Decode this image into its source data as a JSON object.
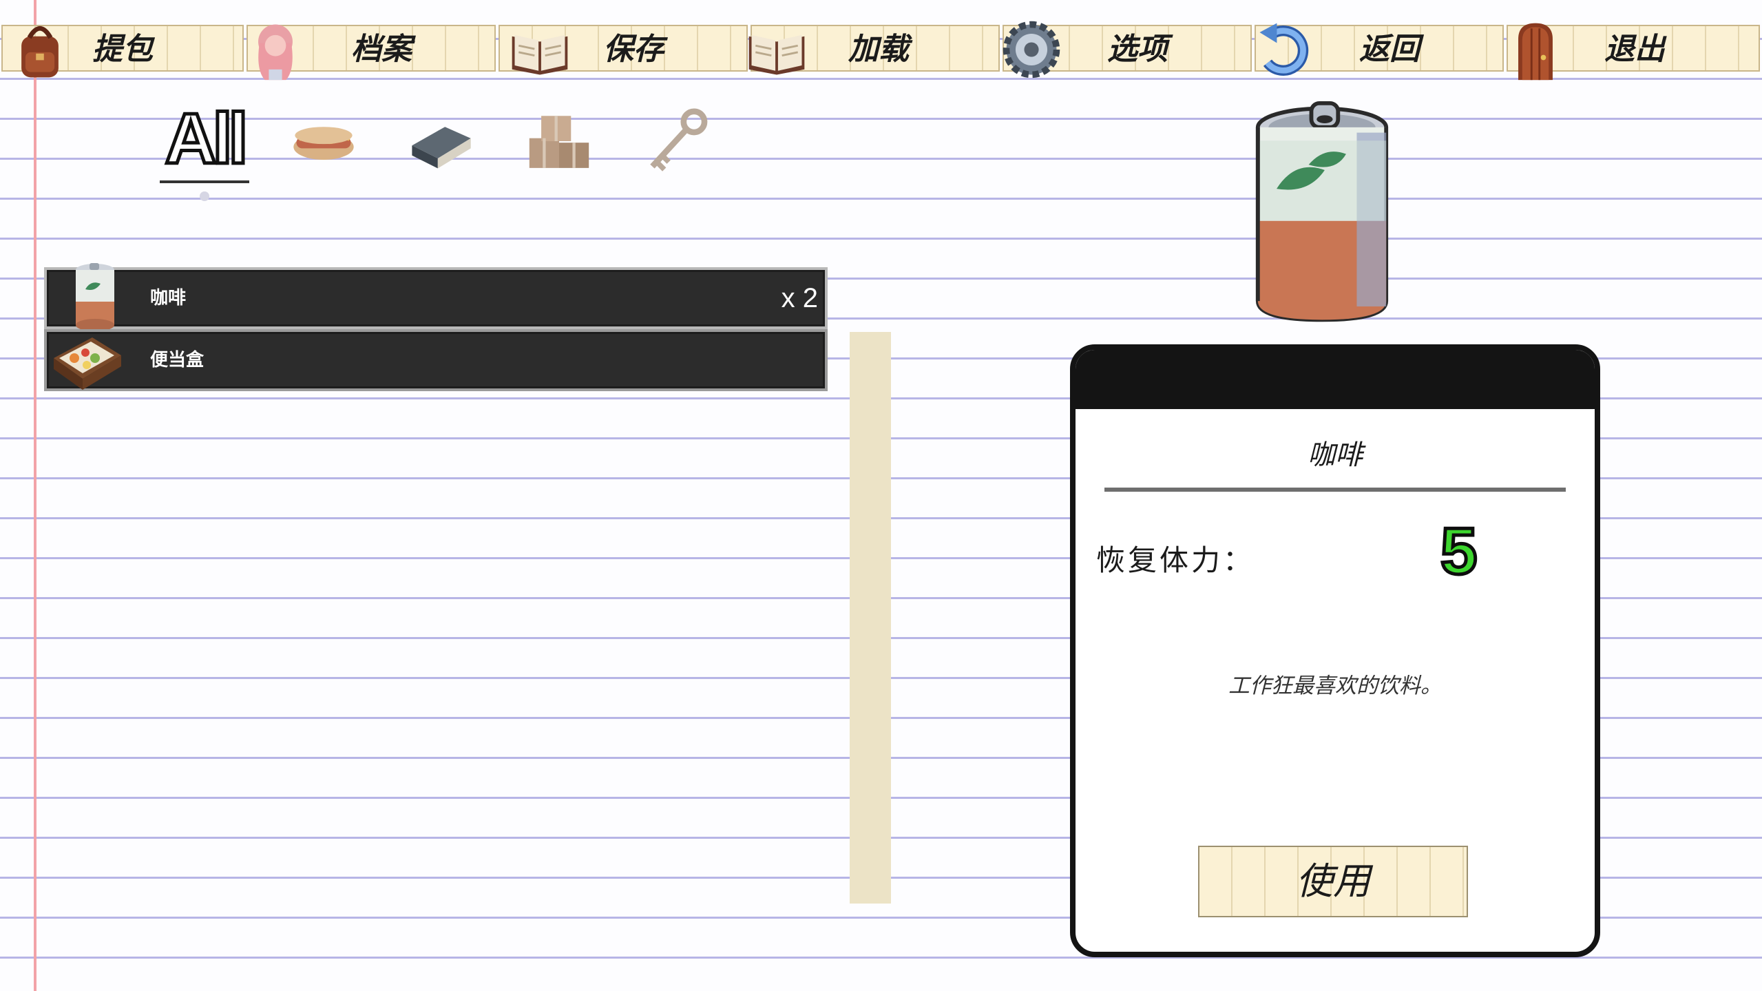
{
  "menu": {
    "items": [
      {
        "label": "提包",
        "icon": "backpack-icon"
      },
      {
        "label": "档案",
        "icon": "girl-portrait-icon"
      },
      {
        "label": "保存",
        "icon": "open-book-icon"
      },
      {
        "label": "加载",
        "icon": "open-book-icon"
      },
      {
        "label": "选项",
        "icon": "gear-icon"
      },
      {
        "label": "返回",
        "icon": "return-arrow-icon"
      },
      {
        "label": "退出",
        "icon": "door-icon"
      }
    ]
  },
  "categories": {
    "all_label": "All",
    "selected": "All",
    "tabs": [
      "food-icon",
      "book-icon",
      "gift-boxes-icon",
      "key-icon"
    ]
  },
  "inventory": {
    "items": [
      {
        "name": "咖啡",
        "count": "x 2",
        "icon": "coffee-can-icon",
        "selected": true
      },
      {
        "name": "便当盒",
        "count": "",
        "icon": "bento-box-icon",
        "selected": false
      }
    ]
  },
  "detail": {
    "title": "咖啡",
    "stat_label": "恢复体力：",
    "stat_value": "5",
    "description": "工作狂最喜欢的饮料。",
    "use_button": "使用",
    "image": "coffee-can-icon"
  },
  "colors": {
    "stat_value": "#3dd62e",
    "row_background": "#2c2c2c",
    "menu_background": "#fbf1d4"
  }
}
